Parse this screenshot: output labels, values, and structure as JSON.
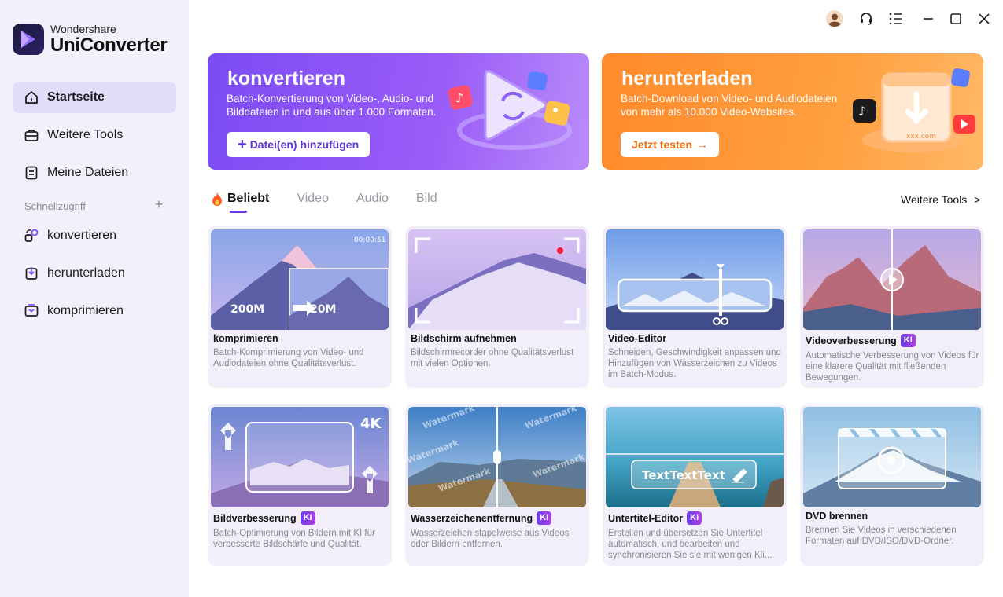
{
  "app": {
    "brand_line1": "Wondershare",
    "brand_line2": "UniConverter"
  },
  "sidebar": {
    "items": [
      {
        "label": "Startseite",
        "icon": "home-icon"
      },
      {
        "label": "Weitere Tools",
        "icon": "toolbox-icon"
      },
      {
        "label": "Meine Dateien",
        "icon": "files-icon"
      }
    ],
    "quick_label": "Schnellzugriff",
    "quick_add": "+",
    "quick_items": [
      {
        "label": "konvertieren",
        "icon": "convert-icon"
      },
      {
        "label": "herunterladen",
        "icon": "download-icon"
      },
      {
        "label": "komprimieren",
        "icon": "compress-icon"
      }
    ]
  },
  "banners": {
    "convert": {
      "title": "konvertieren",
      "desc": "Batch-Konvertierung von Video-, Audio- und Bilddateien in und aus über 1.000 Formaten.",
      "button": "Datei(en) hinzufügen",
      "button_prefix": "+"
    },
    "download": {
      "title": "herunterladen",
      "desc": "Batch-Download von Video- und Audiodateien von mehr als 10.000 Video-Websites.",
      "button": "Jetzt testen",
      "button_suffix": "→",
      "art_text": "xxx.com"
    }
  },
  "tabs": {
    "items": [
      "Beliebt",
      "Video",
      "Audio",
      "Bild"
    ],
    "active": "Beliebt",
    "more": "Weitere Tools",
    "more_chevron": ">"
  },
  "ki_label": "KI",
  "cards": [
    {
      "title": "komprimieren",
      "desc": "Batch-Komprimierung von Video- und Audiodateien ohne Qualitätsverlust.",
      "ki": false,
      "thumb": {
        "time": "00:00:51",
        "from": "200M",
        "to": "20M"
      }
    },
    {
      "title": "Bildschirm aufnehmen",
      "desc": "Bildschirmrecorder ohne Qualitätsverlust mit vielen Optionen.",
      "ki": false
    },
    {
      "title": "Video-Editor",
      "desc": "Schneiden, Geschwindigkeit anpassen und Hinzufügen von Wasserzeichen zu Videos im Batch-Modus.",
      "ki": false
    },
    {
      "title": "Videoverbesserung",
      "desc": "Automatische Verbesserung von Videos für eine klarere Qualität mit fließenden Bewegungen.",
      "ki": true
    },
    {
      "title": "Bildverbesserung",
      "desc": "Batch-Optimierung von Bildern mit KI für verbesserte Bildschärfe und Qualität.",
      "ki": true,
      "thumb": {
        "badge": "4K"
      }
    },
    {
      "title": "Wasserzeichenentfernung",
      "desc": "Wasserzeichen stapelweise aus Videos oder Bildern entfernen.",
      "ki": true,
      "thumb": {
        "watermark": "Watermark"
      }
    },
    {
      "title": "Untertitel-Editor",
      "desc": "Erstellen und übersetzen Sie Untertitel automatisch, und bearbeiten und synchronisieren Sie sie mit wenigen Kli...",
      "ki": true,
      "thumb": {
        "caption": "TextTextText"
      }
    },
    {
      "title": "DVD brennen",
      "desc": "Brennen Sie Videos in verschiedenen Formaten auf DVD/ISO/DVD-Ordner.",
      "ki": false
    }
  ],
  "colors": {
    "accent": "#6d3cf0",
    "sidebar_bg": "#f3f0fb",
    "convert_banner": "#8b55f6",
    "download_banner": "#ff9633",
    "card_bg": "#f2effa"
  }
}
